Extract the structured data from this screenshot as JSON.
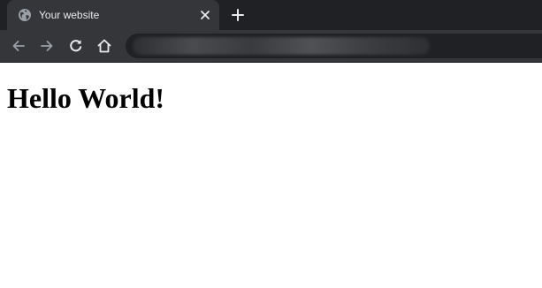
{
  "browser": {
    "tab": {
      "title": "Your website",
      "favicon_icon": "globe-icon",
      "close_icon": "close-icon"
    },
    "new_tab_icon": "plus-icon",
    "toolbar": {
      "back_icon": "arrow-left-icon",
      "forward_icon": "arrow-right-icon",
      "reload_icon": "reload-icon",
      "home_icon": "home-icon",
      "address": "",
      "address_state": "blurred"
    },
    "colors": {
      "tab_strip": "#202124",
      "active_tab": "#35363a",
      "tab_text": "#e8eaed",
      "icon": "#e8eaed",
      "icon_disabled": "#9aa0a6",
      "omnibox": "#202124",
      "page_background": "#ffffff",
      "page_text": "#000000"
    }
  },
  "page": {
    "heading": "Hello World!"
  }
}
